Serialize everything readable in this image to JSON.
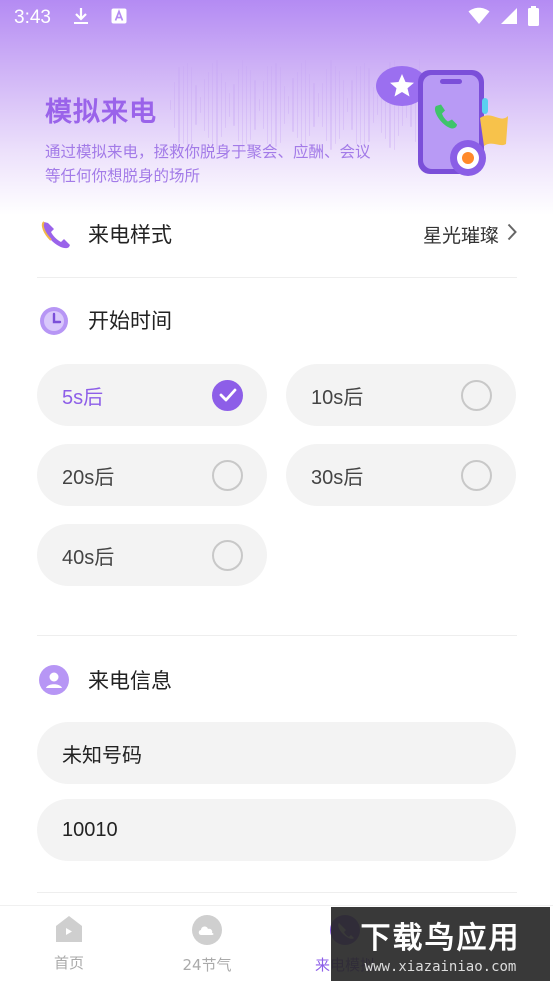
{
  "status_bar": {
    "time": "3:43"
  },
  "hero": {
    "title": "模拟来电",
    "description": "通过模拟来电，拯救你脱身于聚会、应酬、会议等任何你想脱身的场所"
  },
  "call_style": {
    "label": "来电样式",
    "value": "星光璀璨"
  },
  "start_time": {
    "label": "开始时间",
    "options": [
      {
        "label": "5s后",
        "selected": true
      },
      {
        "label": "10s后",
        "selected": false
      },
      {
        "label": "20s后",
        "selected": false
      },
      {
        "label": "30s后",
        "selected": false
      },
      {
        "label": "40s后",
        "selected": false
      }
    ]
  },
  "caller_info": {
    "label": "来电信息",
    "name_value": "未知号码",
    "number_value": "10010"
  },
  "tabs": [
    {
      "label": "首页",
      "icon": "home-icon",
      "active": false
    },
    {
      "label": "24节气",
      "icon": "weather-icon",
      "active": false
    },
    {
      "label": "来电模拟",
      "icon": "phone-icon",
      "active": true
    }
  ],
  "watermark": {
    "main": "下载鸟应用",
    "sub": "www.xiazainiao.com"
  },
  "colors": {
    "accent": "#8d5ee8",
    "hero_title": "#9a63ea",
    "option_bg": "#f3f3f3"
  }
}
